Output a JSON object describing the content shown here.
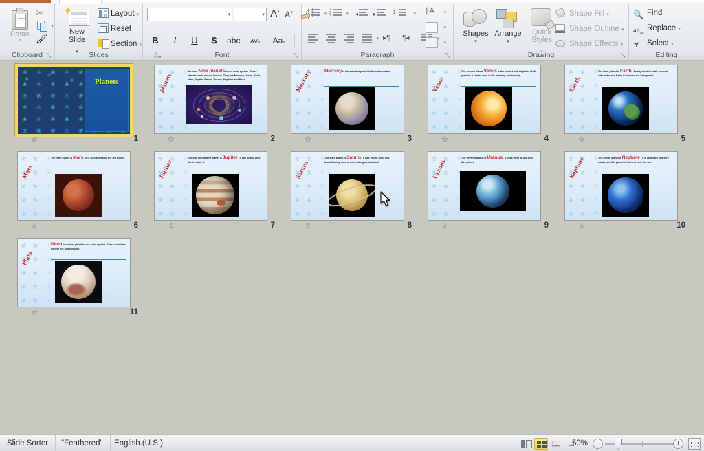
{
  "app": {
    "view_mode": "Slide Sorter",
    "theme": "\"Feathered\"",
    "language": "English (U.S.)",
    "zoom_level": "50%"
  },
  "ribbon": {
    "groups": {
      "clipboard": {
        "label": "Clipboard",
        "paste_label": "Paste",
        "paste_arrow": "▾",
        "cut_icon": "scissors-icon",
        "copy_icon": "copy-icon",
        "format_painter_icon": "format-painter-icon",
        "dialog_launcher": "⤡"
      },
      "slides": {
        "label": "Slides",
        "new_slide_line1": "New",
        "new_slide_line2": "Slide",
        "new_slide_caret": "▾",
        "layout": "Layout",
        "layout_caret": "▾",
        "reset": "Reset",
        "section": "Section",
        "section_caret": "▾"
      },
      "font": {
        "label": "Font",
        "font_name_value": "",
        "font_size_value": "",
        "grow_font": "A",
        "shrink_font": "A",
        "clear_formatting": "clear-formatting-icon",
        "bold": "B",
        "italic": "I",
        "underline": "U",
        "shadow": "S",
        "strikethrough": "abc",
        "character_spacing": "AV",
        "change_case": "Aa",
        "font_color": "A",
        "dialog_launcher": "⤡"
      },
      "paragraph": {
        "label": "Paragraph",
        "bullets": "bullets-icon",
        "numbering": "numbering-icon",
        "decrease_indent": "decrease-indent-icon",
        "increase_indent": "increase-indent-icon",
        "line_spacing": "line-spacing-icon",
        "align_left": "align-left-icon",
        "align_center": "align-center-icon",
        "align_right": "align-right-icon",
        "justify": "justify-icon",
        "text_direction_ltr": "text-direction-icon",
        "text_direction_rtl": "text-direction-rtl-icon",
        "columns": "columns-icon",
        "text_direction": "text-direction-icon",
        "align_text": "align-text-icon",
        "convert_smartart": "convert-to-smartart-icon",
        "dialog_launcher": "⤡"
      },
      "drawing": {
        "label": "Drawing",
        "shapes": "Shapes",
        "shapes_caret": "▾",
        "arrange": "Arrange",
        "arrange_caret": "▾",
        "quick_styles_line1": "Quick",
        "quick_styles_line2": "Styles",
        "quick_styles_caret": "▾",
        "shape_fill": "Shape Fill",
        "shape_outline": "Shape Outline",
        "shape_effects": "Shape Effects",
        "caret": "▾",
        "dialog_launcher": "⤡"
      },
      "editing": {
        "label": "Editing",
        "find": "Find",
        "replace": "Replace",
        "replace_caret": "▾",
        "select": "Select",
        "select_caret": "▾"
      }
    }
  },
  "slides": [
    {
      "number": "1",
      "type": "title",
      "title": "Planets",
      "body": "",
      "selected": true,
      "transition_icon": "transition-star-icon"
    },
    {
      "number": "2",
      "type": "content",
      "vertical_title": "planets",
      "highlight": "Nine planets",
      "body_before": "We have",
      "body_after": "in our solar system. These planets circle around the sun. They are Mercury, Venus, Earth, Mars, Jupiter, Saturn, Uranus, Neptune and Pluto.",
      "image": "solar-system-image",
      "selected": false,
      "transition_icon": "transition-star-icon"
    },
    {
      "number": "3",
      "type": "content",
      "vertical_title": "Mercury",
      "highlight": "Mercury",
      "body_before": "",
      "body_after": "is the smallest planet in the solar system.",
      "image": "mercury-image",
      "selected": false,
      "transition_icon": "transition-star-icon"
    },
    {
      "number": "4",
      "type": "content",
      "vertical_title": "Venus",
      "highlight": "Venus",
      "body_before": "The second planet",
      "body_after": "is the hottest and brightest of all planets. It can be seen in the morning and evening.",
      "image": "venus-image",
      "selected": false,
      "transition_icon": "transition-star-icon"
    },
    {
      "number": "5",
      "type": "content",
      "vertical_title": "Earth",
      "highlight": "Earth",
      "body_before": "The third planet is",
      "body_after": ". Nearly most of earth covered with water and Earth is denoted the blue planet.",
      "image": "earth-image",
      "selected": false,
      "transition_icon": "transition-star-icon"
    },
    {
      "number": "6",
      "type": "content",
      "vertical_title": "Mars",
      "highlight": "Mars",
      "body_before": "The forth planet is",
      "body_after": ". It is also known as the red planet.",
      "image": "mars-image",
      "selected": false,
      "transition_icon": "transition-star-icon"
    },
    {
      "number": "7",
      "type": "content",
      "vertical_title": "Jupiter",
      "highlight": "Jupiter",
      "body_before": "The fifth and largest planet is",
      "body_after": ". It can nearly 1300 Earth inside it.",
      "image": "jupiter-image",
      "selected": false,
      "transition_icon": "transition-star-icon"
    },
    {
      "number": "8",
      "type": "content",
      "vertical_title": "Saturn",
      "highlight": "Saturn",
      "body_before": "The sixth planet is",
      "body_after": ". It has yellow color and beautiful ring around and making ice and dust.",
      "image": "saturn-image",
      "selected": false,
      "transition_icon": "transition-star-icon"
    },
    {
      "number": "9",
      "type": "content",
      "vertical_title": "Uranus",
      "highlight": "Uranus",
      "body_before": "The seventh planet is",
      "body_after": ". A thick layer of gas over this planet.",
      "image": "uranus-image",
      "selected": false,
      "transition_icon": "transition-star-icon"
    },
    {
      "number": "10",
      "type": "content",
      "vertical_title": "Neptune",
      "highlight": "Neptune",
      "body_before": "The eighth planet is",
      "body_after": ". It is cold dark and very windy and this planet is farthest from the sun.",
      "image": "neptune-image",
      "selected": false,
      "transition_icon": "transition-star-icon"
    },
    {
      "number": "11",
      "type": "content",
      "vertical_title": "Pluto",
      "highlight": "Pluto",
      "body_before": "",
      "body_after": "is coldest planet in our solar system. Some scientists believe the plane is icon.",
      "image": "pluto-image",
      "selected": false,
      "transition_icon": "transition-star-icon"
    }
  ],
  "statusbar": {
    "view_buttons": [
      {
        "name": "normal-view",
        "label": "Normal",
        "active": false
      },
      {
        "name": "slide-sorter-view",
        "label": "Slide Sorter",
        "active": true
      },
      {
        "name": "reading-view",
        "label": "Reading View",
        "active": false
      },
      {
        "name": "slide-show-view",
        "label": "Slide Show",
        "active": false
      }
    ],
    "zoom_out": "−",
    "zoom_in": "+",
    "fit_to_window": "fit-slide-to-window-icon"
  },
  "colors": {
    "accent_yellow": "#f3d66b",
    "selection_border": "#f3d66b",
    "title_text": "#ddf03d",
    "heading_red": "#c0262b",
    "rule_blue": "#2f88b5",
    "slide_bg_light": "#e7f3fb",
    "slide_bg_dark": "#1d3e6e",
    "workspace_bg": "#c8c8c0"
  }
}
